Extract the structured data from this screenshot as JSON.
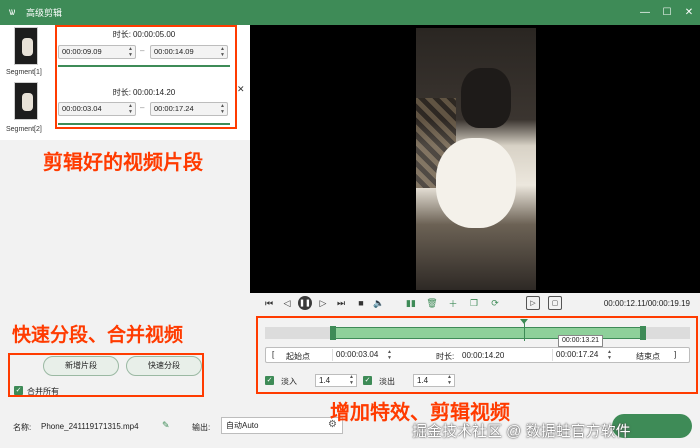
{
  "window": {
    "title": "高级剪辑",
    "app_icon": "rabbit-icon"
  },
  "segments": [
    {
      "label": "Segment[1]",
      "duration_label": "时长:",
      "duration": "00:00:05.00",
      "start": "00:00:09.09",
      "end": "00:00:14.09"
    },
    {
      "label": "Segment[2]",
      "duration_label": "时长:",
      "duration": "00:00:14.20",
      "start": "00:00:03.04",
      "end": "00:00:17.24"
    }
  ],
  "annotations": {
    "segments_note": "剪辑好的视频片段",
    "split_note": "快速分段、合并视频",
    "effects_note": "增加特效、剪辑视频",
    "color": "#ff3b00"
  },
  "left_actions": {
    "new_segment": "新增片段",
    "quick_split": "快速分段",
    "merge_all": "合并所有"
  },
  "player": {
    "time_readout": "00:00:12.11/00:00:19.19"
  },
  "timeline": {
    "tooltip": "00:00:13.21",
    "selection_start_fraction": 0.16,
    "selection_end_fraction": 0.89,
    "playhead_fraction": 0.61
  },
  "range": {
    "start_label": "起始点",
    "start_value": "00:00:03.04",
    "duration_label": "时长:",
    "duration_value": "00:00:14.20",
    "end_value": "00:00:17.24",
    "end_label": "结束点",
    "bracket_open": "[",
    "bracket_close": "]"
  },
  "effects": {
    "fade_in_label": "淡入",
    "fade_in_value": "1.4",
    "fade_out_label": "淡出",
    "fade_out_value": "1.4"
  },
  "bottom": {
    "name_label": "名称:",
    "name_value": "Phone_241119171315.mp4",
    "output_label": "输出:",
    "output_value": "自动Auto"
  },
  "watermark": "掘金技术社区 @ 数据蛙官方软件",
  "colors": {
    "accent": "#3e8b57",
    "titlebar": "#3e8b57"
  }
}
